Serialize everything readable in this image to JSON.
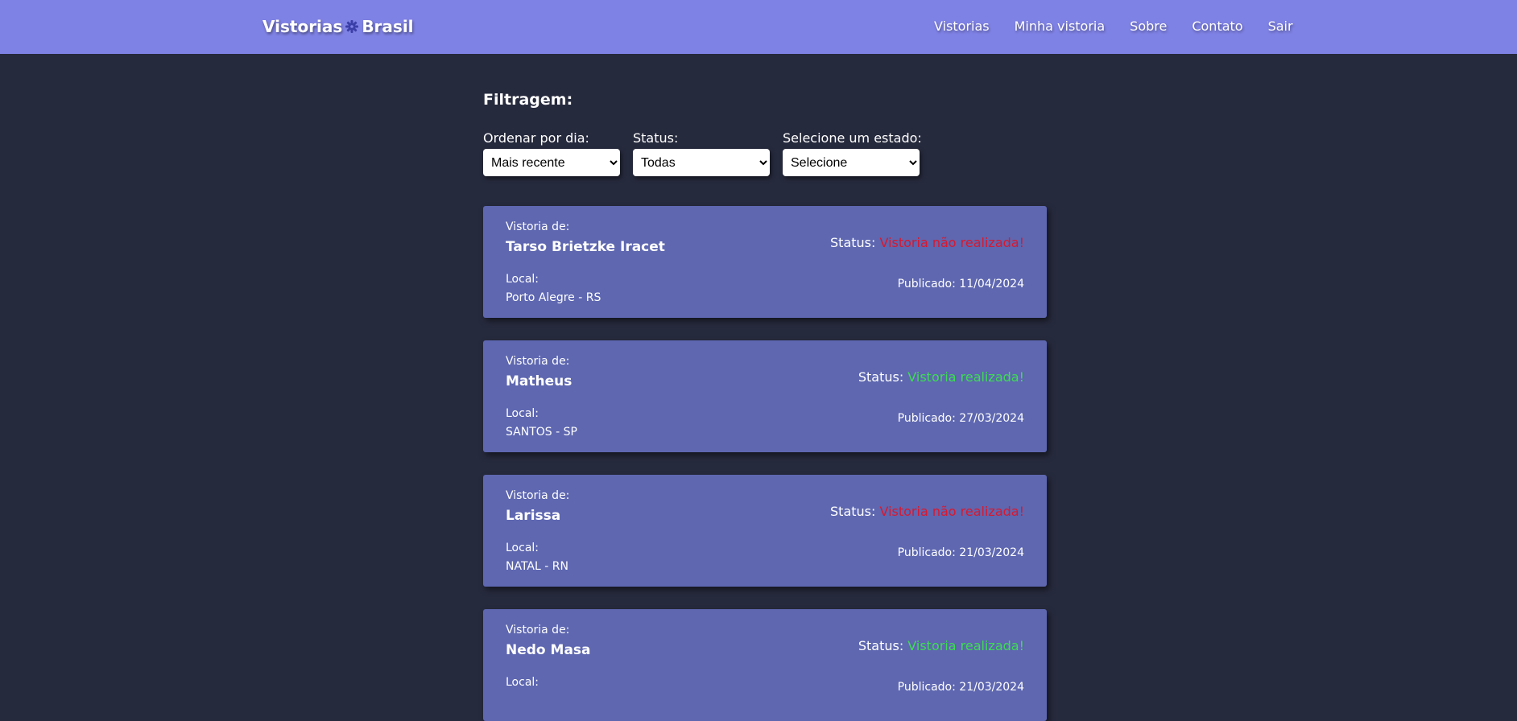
{
  "navbar": {
    "brand_left": "Vistorias",
    "brand_right": "Brasil",
    "brand_icon": "gear-icon",
    "links": [
      "Vistorias",
      "Minha vistoria",
      "Sobre",
      "Contato",
      "Sair"
    ]
  },
  "filters": {
    "title": "Filtragem:",
    "order": {
      "label": "Ordenar por dia:",
      "value": "Mais recente"
    },
    "status": {
      "label": "Status:",
      "value": "Todas"
    },
    "state": {
      "label": "Selecione um estado:",
      "value": "Selecione"
    }
  },
  "colors": {
    "navbar": "#7f82e5",
    "background": "#262a3d",
    "card": "#5e67b0",
    "status_not_done": "#d9182f",
    "status_done": "#3ddc53"
  },
  "card_labels": {
    "vistoria_de": "Vistoria de:",
    "local": "Local:",
    "status": "Status:",
    "published": "Publicado:"
  },
  "vistorias": [
    {
      "name": "Tarso Brietzke Iracet",
      "local": "Porto Alegre - RS",
      "status": "Vistoria não realizada!",
      "status_done": false,
      "published": "11/04/2024"
    },
    {
      "name": "Matheus",
      "local": "SANTOS - SP",
      "status": "Vistoria realizada!",
      "status_done": true,
      "published": "27/03/2024"
    },
    {
      "name": "Larissa",
      "local": "NATAL - RN",
      "status": "Vistoria não realizada!",
      "status_done": false,
      "published": "21/03/2024"
    },
    {
      "name": "Nedo Masa",
      "local": "",
      "status": "Vistoria realizada!",
      "status_done": true,
      "published": "21/03/2024"
    }
  ]
}
